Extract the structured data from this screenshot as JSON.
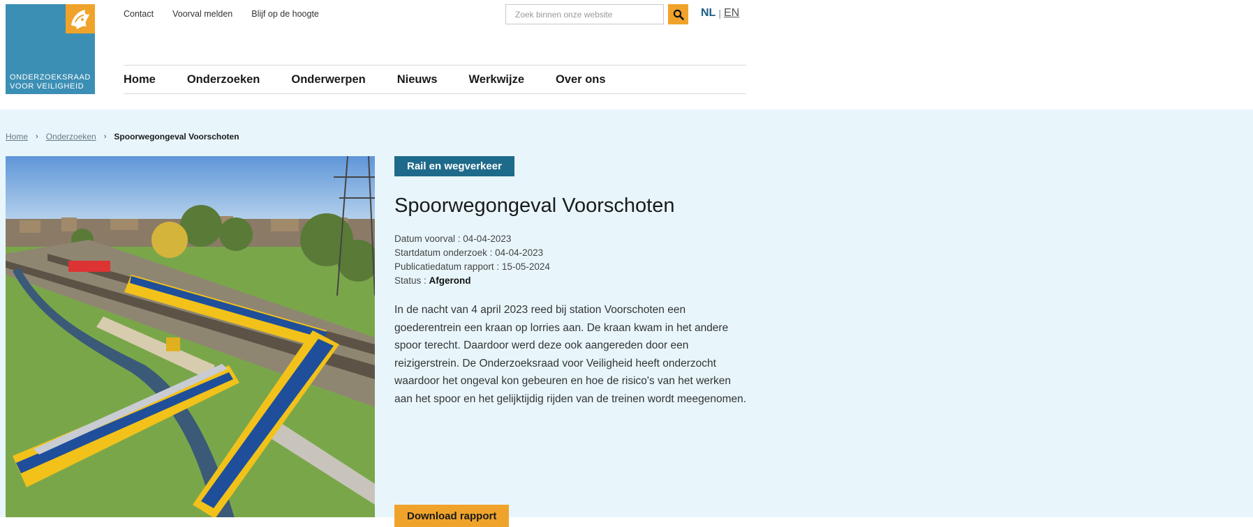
{
  "logo": {
    "line1": "ONDERZOEKSRAAD",
    "line2": "VOOR VEILIGHEID"
  },
  "top_links": [
    "Contact",
    "Voorval melden",
    "Blijf op de hoogte"
  ],
  "search": {
    "placeholder": "Zoek binnen onze website",
    "icon": "search-icon"
  },
  "language": {
    "active": "NL",
    "separator": "|",
    "other": "EN"
  },
  "nav": [
    "Home",
    "Onderzoeken",
    "Onderwerpen",
    "Nieuws",
    "Werkwijze",
    "Over ons"
  ],
  "breadcrumb": {
    "items": [
      "Home",
      "Onderzoeken"
    ],
    "current": "Spoorwegongeval Voorschoten"
  },
  "article": {
    "tag": "Rail en wegverkeer",
    "title": "Spoorwegongeval Voorschoten",
    "meta": [
      {
        "label": "Datum voorval : ",
        "value": "04-04-2023"
      },
      {
        "label": "Startdatum onderzoek : ",
        "value": "04-04-2023"
      },
      {
        "label": "Publicatiedatum rapport : ",
        "value": "15-05-2024"
      }
    ],
    "status_label": "Status : ",
    "status_value": "Afgerond",
    "intro": "In de nacht van 4 april 2023 reed bij station Voorschoten een goederentrein een kraan op lorries aan. De kraan kwam in het andere spoor terecht. Daardoor werd deze ook aangereden door een reizigerstrein. De Onderzoeksraad voor Veiligheid heeft onderzocht waardoor het ongeval kon gebeuren en hoe de risico's van het werken aan het spoor en het gelijktijdig rijden van de treinen wordt meegenomen.",
    "download_label": "Download rapport"
  },
  "colors": {
    "brand_blue": "#3c8fb4",
    "tag_blue": "#1e6a8a",
    "accent_orange": "#f0a32b",
    "page_bg": "#e8f6fc"
  }
}
